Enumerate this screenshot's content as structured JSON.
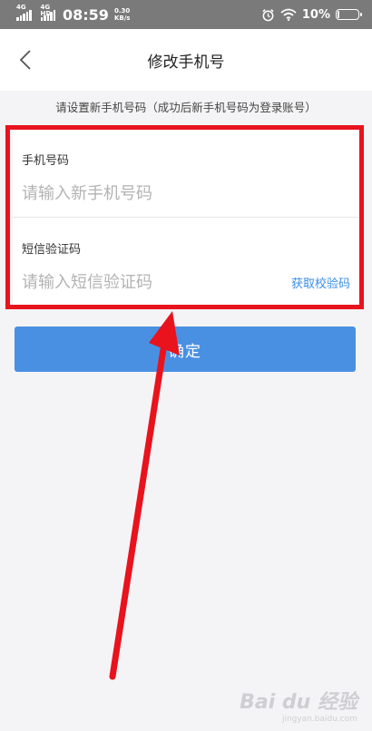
{
  "status_bar": {
    "net1": "4G",
    "net2": "4G HD",
    "time": "08:59",
    "speed_value": "0.30",
    "speed_unit": "KB/s",
    "battery_pct": "10%",
    "battery_level": 0.1,
    "icons": [
      "signal-icon",
      "alarm-icon",
      "wifi-icon",
      "battery-icon"
    ]
  },
  "nav": {
    "title": "修改手机号",
    "back_icon": "chevron-left-icon"
  },
  "hint": "请设置新手机号码（成功后新手机号码为登录账号）",
  "form": {
    "phone_label": "手机号码",
    "phone_placeholder": "请输入新手机号码",
    "phone_value": "",
    "code_label": "短信验证码",
    "code_placeholder": "请输入短信验证码",
    "code_value": "",
    "get_code_label": "获取校验码"
  },
  "confirm_label": "确定",
  "annotation": {
    "box_color": "#e8131d",
    "arrow_color": "#e8131d"
  },
  "watermark": {
    "logo": "Bai du 经验",
    "site": "jingyan.baidu.com"
  },
  "colors": {
    "accent": "#4a90e2",
    "link": "#3a8ee6",
    "status_bar_bg": "#7a7a7a"
  }
}
